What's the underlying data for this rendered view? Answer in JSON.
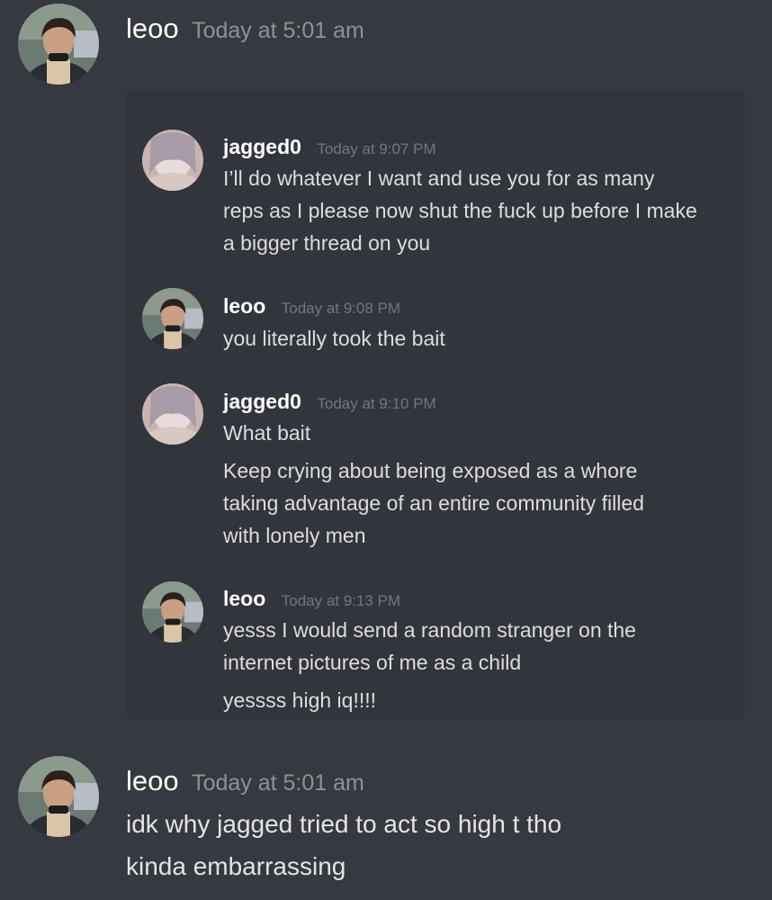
{
  "colors": {
    "background": "#36393f",
    "embed_background": "#32353b",
    "username": "#ffffff",
    "timestamp": "#8e9297",
    "text": "#dcddde"
  },
  "outer_messages": [
    {
      "avatar": "leoo-avatar",
      "username": "leoo",
      "timestamp": "Today at 5:01 am",
      "lines": []
    },
    {
      "avatar": "leoo-avatar",
      "username": "leoo",
      "timestamp": "Today at 5:01 am",
      "lines": [
        "idk why jagged tried to act so high t tho",
        "kinda embarrassing"
      ]
    }
  ],
  "embed_messages": [
    {
      "avatar": "jagged0-avatar",
      "username": "jagged0",
      "timestamp": "Today at 9:07 PM",
      "lines": [
        "I’ll do whatever I want and use you for as many",
        "reps as I please now shut the fuck up before I make",
        "a bigger thread on you"
      ]
    },
    {
      "avatar": "leoo-avatar",
      "username": "leoo",
      "timestamp": "Today at 9:08 PM",
      "lines": [
        "you literally took the bait"
      ]
    },
    {
      "avatar": "jagged0-avatar",
      "username": "jagged0",
      "timestamp": "Today at 9:10 PM",
      "lines": [
        "What bait",
        "Keep crying about being exposed as a whore",
        "taking advantage of an entire community filled",
        "with lonely men"
      ]
    },
    {
      "avatar": "leoo-avatar",
      "username": "leoo",
      "timestamp": "Today at 9:13 PM",
      "lines": [
        "yesss I would send a random stranger on the",
        "internet pictures of me as a child",
        "yessss high iq!!!!"
      ]
    }
  ]
}
